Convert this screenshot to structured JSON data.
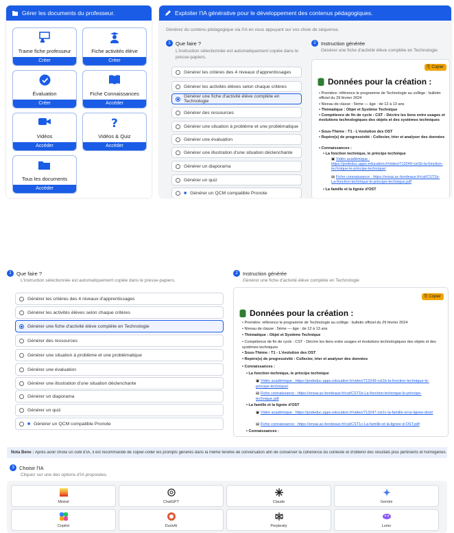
{
  "colors": {
    "accent": "#1a5ce6",
    "copy": "#f2a400",
    "selected_bg": "#eef3ff"
  },
  "left_panel": {
    "title": "Gérer les documents du professeur.",
    "cards": [
      {
        "title": "Trame fiche professeur",
        "button": "Créer",
        "icon": "presentation-icon"
      },
      {
        "title": "Fiche activités élève",
        "button": "Créer",
        "icon": "student-icon"
      },
      {
        "title": "Évaluation",
        "button": "Créer",
        "icon": "check-circle-icon"
      },
      {
        "title": "Fiche Connaissances",
        "button": "Accéder",
        "icon": "book-icon"
      },
      {
        "title": "Vidéos",
        "button": "Accéder",
        "icon": "video-icon"
      },
      {
        "title": "Vidéos & Quiz",
        "button": "Accéder",
        "icon": "question-icon"
      },
      {
        "title": "Tous les documents",
        "button": "Accéder",
        "icon": "folder-icon"
      }
    ]
  },
  "right_panel": {
    "title": "Exploiter l'IA générative pour le développement des contenus pédagogiques.",
    "subtitle": "Générez du contenu pédagogique via l'IA en vous appuyant sur vos choix de séquence.",
    "step1_title": "Que faire ?",
    "step1_desc": "L'instruction sélectionnée est automatiquement copiée dans le presse-papiers.",
    "step1_desc_cut": "papiers",
    "step2_title": "Instruction générée",
    "step2_desc": "Générer une fiche d'activité élève complète en Technologie",
    "options": [
      "Générer les critères des 4 niveaux d'apprentissages",
      "Générer les activités élèves selon chaque critères",
      "Générer une fiche d'activité élève complète en Technologie",
      "Générer des ressources",
      "Générer une situation à problème et une problématique",
      "Générer une évaluation",
      "Générer une illustration d'une situation déclenchante",
      "Générer un diaporama",
      "Générer un quiz",
      "Générer un QCM compatible Pronote"
    ],
    "selected_index": 2,
    "copy_label": "Copier",
    "gen_title": "Données pour la création :",
    "gen_lines": [
      "Première: référence le programme de Technologie au collège : bulletin officiel du 29 février 2024",
      "Niveau de classe : 5ème — âge : de 12 à 13 ans",
      "Thématique : Objet et Système Technique",
      "Compétence de fin de cycle : CST - Décrire les liens entre usages et évolutions technologiques des objets et des systèmes techniques",
      "Sous-Thème : T1 - L'évolution des OST",
      "Repère(s) de progressivité : Collecter, trier et analyser des données",
      "Connaissances :",
      "La fonction technique, le principe technique",
      "Vidéo académique : https://podeduc.apps.education.fr/video/713249-cst1b-la-fonction-technique-le-principe-technique/",
      "Fiche connaissance : https://ensai.ac-bordeaux.fr/cst/CST1b-La-fonction-technique-le-principe-technique.pdf",
      "La famille et la lignée d'OST",
      "Vidéo académique : https://podeduc.apps.education.fr/video/713247-cst1c-la-famille-et-la-lignee-dost/",
      "Fiche connaissance : https://ensai.ac-bordeaux.fr/cst/CST1c-La-famille-et-la-lignee-d-OST.pdf",
      "Connaissances :"
    ]
  },
  "bottom": {
    "note_label": "Nota Bene :",
    "note_text": "Après avoir choisi un outil d'IA, il est recommandé de copier-coller les prompts générés dans la même fenêtre de conversation afin de conserver la cohérence du contexte et d'obtenir des résultats plus pertinents et homogènes.",
    "step3_title": "Choisir l'IA",
    "step3_desc": "Cliquez sur une des options d'IA proposées.",
    "ai_tools": [
      "Mistral",
      "ChatGPT",
      "Claude",
      "Gemini",
      "Copilot",
      "DuckAI",
      "Perplexity",
      "Lumo"
    ]
  }
}
